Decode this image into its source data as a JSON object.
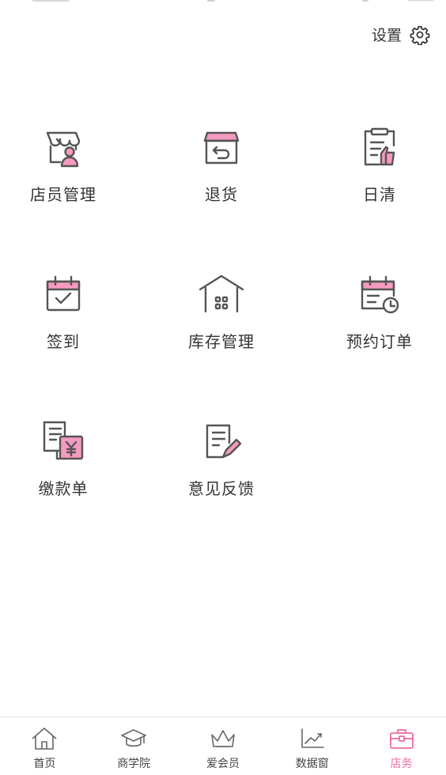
{
  "header": {
    "settings_label": "设置",
    "settings_icon": "gear-icon"
  },
  "colors": {
    "accent_pink": "#f59ac0",
    "active_tab": "#f06aa0",
    "icon_stroke": "#555555"
  },
  "grid": {
    "items": [
      {
        "label": "店员管理",
        "icon": "clerk-store-icon"
      },
      {
        "label": "退货",
        "icon": "return-box-icon"
      },
      {
        "label": "日清",
        "icon": "daily-clear-icon"
      },
      {
        "label": "签到",
        "icon": "calendar-check-icon"
      },
      {
        "label": "库存管理",
        "icon": "warehouse-icon"
      },
      {
        "label": "预约订单",
        "icon": "calendar-clock-icon"
      },
      {
        "label": "缴款单",
        "icon": "payment-slip-icon"
      },
      {
        "label": "意见反馈",
        "icon": "feedback-edit-icon"
      }
    ]
  },
  "tabbar": {
    "items": [
      {
        "label": "首页",
        "icon": "home-icon",
        "active": false
      },
      {
        "label": "商学院",
        "icon": "graduation-cap-icon",
        "active": false
      },
      {
        "label": "爱会员",
        "icon": "crown-icon",
        "active": false
      },
      {
        "label": "数据窗",
        "icon": "trend-chart-icon",
        "active": false
      },
      {
        "label": "店务",
        "icon": "briefcase-icon",
        "active": true
      }
    ]
  }
}
